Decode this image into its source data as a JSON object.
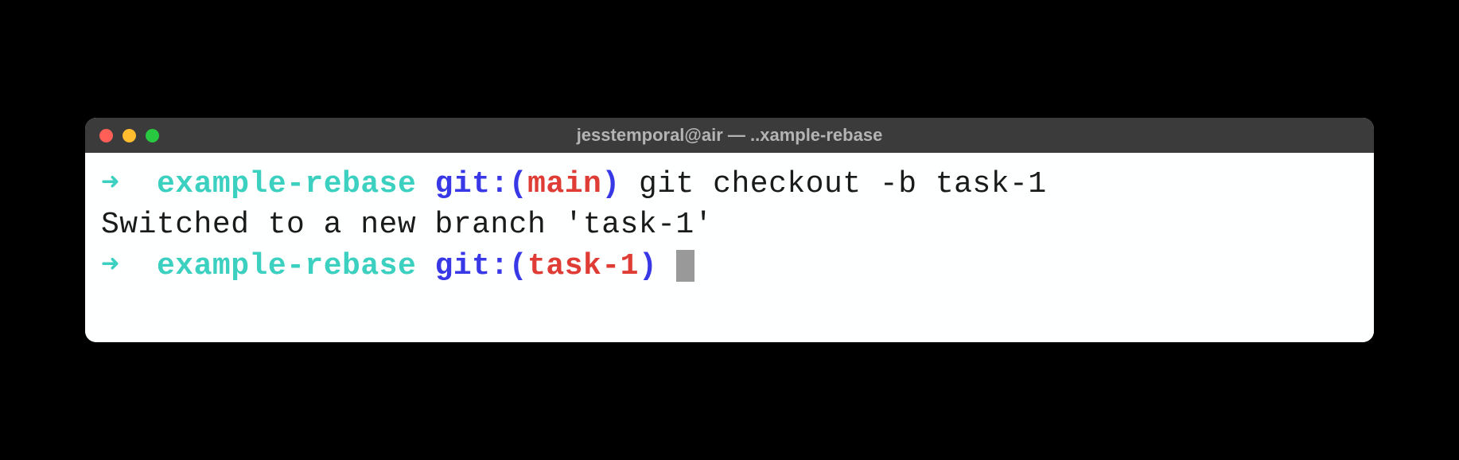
{
  "window": {
    "title": "jesstemporal@air — ..xample-rebase"
  },
  "lines": {
    "line1": {
      "arrow": "➜",
      "directory": "example-rebase",
      "git_prefix": "git:(",
      "branch": "main",
      "git_suffix": ")",
      "command": "git checkout -b task-1"
    },
    "line2": {
      "output": "Switched to a new branch 'task-1'"
    },
    "line3": {
      "arrow": "➜",
      "directory": "example-rebase",
      "git_prefix": "git:(",
      "branch": "task-1",
      "git_suffix": ")"
    }
  }
}
